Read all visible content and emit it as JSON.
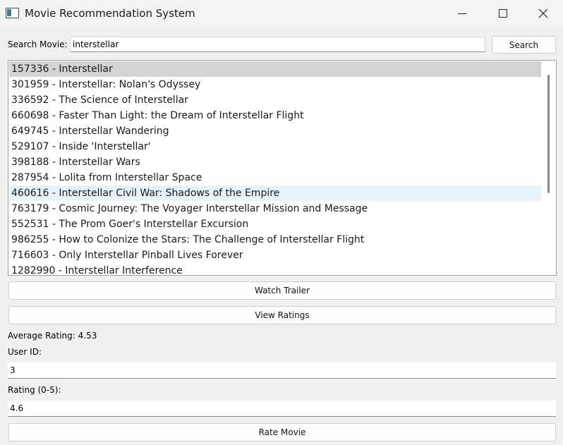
{
  "window": {
    "title": "Movie Recommendation System",
    "icon": "app-window-icon"
  },
  "search": {
    "label": "Search Movie:",
    "value": "interstellar",
    "button_label": "Search"
  },
  "results": {
    "selected_index": 0,
    "hover_index": 8,
    "items": [
      "157336 - Interstellar",
      "301959 - Interstellar: Nolan's Odyssey",
      "336592 - The Science of Interstellar",
      "660698 - Faster Than Light: the Dream of Interstellar Flight",
      "649745 - Interstellar Wandering",
      "529107 - Inside 'Interstellar'",
      "398188 - Interstellar Wars",
      "287954 - Lolita from Interstellar Space",
      "460616 - Interstellar Civil War: Shadows of the Empire",
      "763179 - Cosmic Journey: The Voyager Interstellar Mission and Message",
      "552531 - The Prom Goer's Interstellar Excursion",
      "986255 - How to Colonize the Stars: The Challenge of Interstellar Flight",
      "716603 - Only Interstellar Pinball Lives Forever",
      "1282990 - Interstellar Interference"
    ]
  },
  "actions": {
    "watch_trailer": "Watch Trailer",
    "view_ratings": "View Ratings",
    "rate_movie": "Rate Movie"
  },
  "rating": {
    "average_label": "Average Rating: 4.53",
    "user_id_label": "User ID:",
    "user_id_value": "3",
    "rating_label": "Rating (0-5):",
    "rating_value": "4.6"
  }
}
